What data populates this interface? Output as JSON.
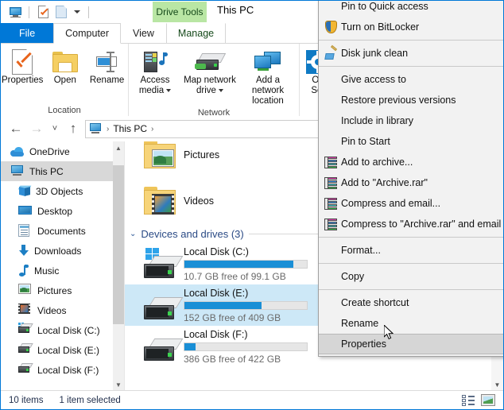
{
  "window": {
    "title": "This PC",
    "contextual_tab_group": "Drive Tools"
  },
  "quick_access_toolbar": {
    "items": [
      {
        "name": "this-pc-icon",
        "label": "This PC"
      },
      {
        "name": "properties-icon",
        "label": "Properties"
      },
      {
        "name": "new-folder-icon",
        "label": "New folder"
      },
      {
        "name": "customize-caret",
        "label": "Customize Quick Access Toolbar"
      }
    ]
  },
  "ribbon": {
    "tabs": [
      {
        "label": "File",
        "state": "file"
      },
      {
        "label": "Computer",
        "state": "active"
      },
      {
        "label": "View",
        "state": "normal"
      },
      {
        "label": "Manage",
        "state": "contextual"
      }
    ],
    "groups": [
      {
        "label": "Location",
        "buttons": [
          {
            "label": "Properties",
            "icon": "properties-icon",
            "split": false
          },
          {
            "label": "Open",
            "icon": "open-folder-icon",
            "split": false
          },
          {
            "label": "Rename",
            "icon": "rename-icon",
            "split": false
          }
        ]
      },
      {
        "label": "Network",
        "buttons": [
          {
            "label": "Access media",
            "icon": "access-media-icon",
            "split": true
          },
          {
            "label": "Map network drive",
            "icon": "map-network-drive-icon",
            "split": true
          },
          {
            "label": "Add a network location",
            "icon": "add-network-location-icon",
            "split": false
          }
        ]
      },
      {
        "label": "",
        "buttons": [
          {
            "label": "Open Settings",
            "label_line1": "Op",
            "label_line2": "Set",
            "icon": "settings-icon",
            "split": false
          }
        ]
      }
    ]
  },
  "addressbar": {
    "back": "←",
    "forward": "→",
    "recent": "˅",
    "up": "↑",
    "path_icon": "this-pc-icon",
    "crumbs": [
      "This PC"
    ],
    "separator": "›",
    "dropdown": "˅"
  },
  "navigation_pane": {
    "items": [
      {
        "label": "OneDrive",
        "icon": "onedrive-icon",
        "level": 0,
        "selected": false
      },
      {
        "label": "This PC",
        "icon": "this-pc-icon",
        "level": 0,
        "selected": true
      },
      {
        "label": "3D Objects",
        "icon": "3d-objects-icon",
        "level": 1,
        "selected": false
      },
      {
        "label": "Desktop",
        "icon": "desktop-icon",
        "level": 1,
        "selected": false
      },
      {
        "label": "Documents",
        "icon": "documents-icon",
        "level": 1,
        "selected": false
      },
      {
        "label": "Downloads",
        "icon": "downloads-icon",
        "level": 1,
        "selected": false
      },
      {
        "label": "Music",
        "icon": "music-icon",
        "level": 1,
        "selected": false
      },
      {
        "label": "Pictures",
        "icon": "pictures-icon",
        "level": 1,
        "selected": false
      },
      {
        "label": "Videos",
        "icon": "videos-icon",
        "level": 1,
        "selected": false
      },
      {
        "label": "Local Disk (C:)",
        "icon": "local-disk-c-icon",
        "level": 1,
        "selected": false
      },
      {
        "label": "Local Disk (E:)",
        "icon": "local-disk-e-icon",
        "level": 1,
        "selected": false
      },
      {
        "label": "Local Disk (F:)",
        "icon": "local-disk-f-icon",
        "level": 1,
        "selected": false
      }
    ]
  },
  "content": {
    "folders": [
      {
        "name": "Pictures",
        "icon": "pictures-folder-icon"
      },
      {
        "name": "Videos",
        "icon": "videos-folder-icon"
      }
    ],
    "group_header": {
      "chevron": "⌄",
      "title": "Devices and drives (3)"
    },
    "drives": [
      {
        "name": "Local Disk (C:)",
        "free_text": "10.7 GB free of 99.1 GB",
        "free_gb": 10.7,
        "total_gb": 99.1,
        "used_percent": 89,
        "selected": false,
        "has_windows_logo": true,
        "bar_color": "#1a8fd6"
      },
      {
        "name": "Local Disk (E:)",
        "free_text": "152 GB free of 409 GB",
        "free_gb": 152,
        "total_gb": 409,
        "used_percent": 63,
        "selected": true,
        "has_windows_logo": false,
        "bar_color": "#1a8fd6"
      },
      {
        "name": "Local Disk (F:)",
        "free_text": "386 GB free of 422 GB",
        "free_gb": 386,
        "total_gb": 422,
        "used_percent": 9,
        "selected": false,
        "has_windows_logo": false,
        "bar_color": "#1a8fd6"
      }
    ]
  },
  "context_menu": {
    "items": [
      {
        "label": "Pin to Quick access",
        "icon": null,
        "highlighted": false,
        "separator_after": false
      },
      {
        "label": "Turn on BitLocker",
        "icon": "shield-icon",
        "highlighted": false,
        "separator_after": true
      },
      {
        "label": "Disk junk clean",
        "icon": "broom-icon",
        "highlighted": false,
        "separator_after": true
      },
      {
        "label": "Give access to",
        "icon": null,
        "highlighted": false,
        "separator_after": false
      },
      {
        "label": "Restore previous versions",
        "icon": null,
        "highlighted": false,
        "separator_after": false
      },
      {
        "label": "Include in library",
        "icon": null,
        "highlighted": false,
        "separator_after": false
      },
      {
        "label": "Pin to Start",
        "icon": null,
        "highlighted": false,
        "separator_after": false
      },
      {
        "label": "Add to archive...",
        "icon": "rar-icon",
        "highlighted": false,
        "separator_after": false
      },
      {
        "label": "Add to \"Archive.rar\"",
        "icon": "rar-icon",
        "highlighted": false,
        "separator_after": false
      },
      {
        "label": "Compress and email...",
        "icon": "rar-icon",
        "highlighted": false,
        "separator_after": false
      },
      {
        "label": "Compress to \"Archive.rar\" and email",
        "icon": "rar-icon",
        "highlighted": false,
        "separator_after": true
      },
      {
        "label": "Format...",
        "icon": null,
        "highlighted": false,
        "separator_after": true
      },
      {
        "label": "Copy",
        "icon": null,
        "highlighted": false,
        "separator_after": true
      },
      {
        "label": "Create shortcut",
        "icon": null,
        "highlighted": false,
        "separator_after": false
      },
      {
        "label": "Rename",
        "icon": null,
        "highlighted": false,
        "separator_after": false
      },
      {
        "label": "Properties",
        "icon": null,
        "highlighted": true,
        "separator_after": false
      }
    ]
  },
  "statusbar": {
    "item_count": "10 items",
    "selection": "1 item selected",
    "view_buttons": [
      {
        "name": "details-view-button",
        "label": "Details view"
      },
      {
        "name": "large-icons-view-button",
        "label": "Large icons view"
      }
    ]
  },
  "colors": {
    "accent": "#0078d7",
    "selection": "#cde8f7",
    "contextual_tab": "#b9e6a4",
    "drive_bar": "#1a8fd6",
    "group_header_text": "#2a4a85"
  }
}
